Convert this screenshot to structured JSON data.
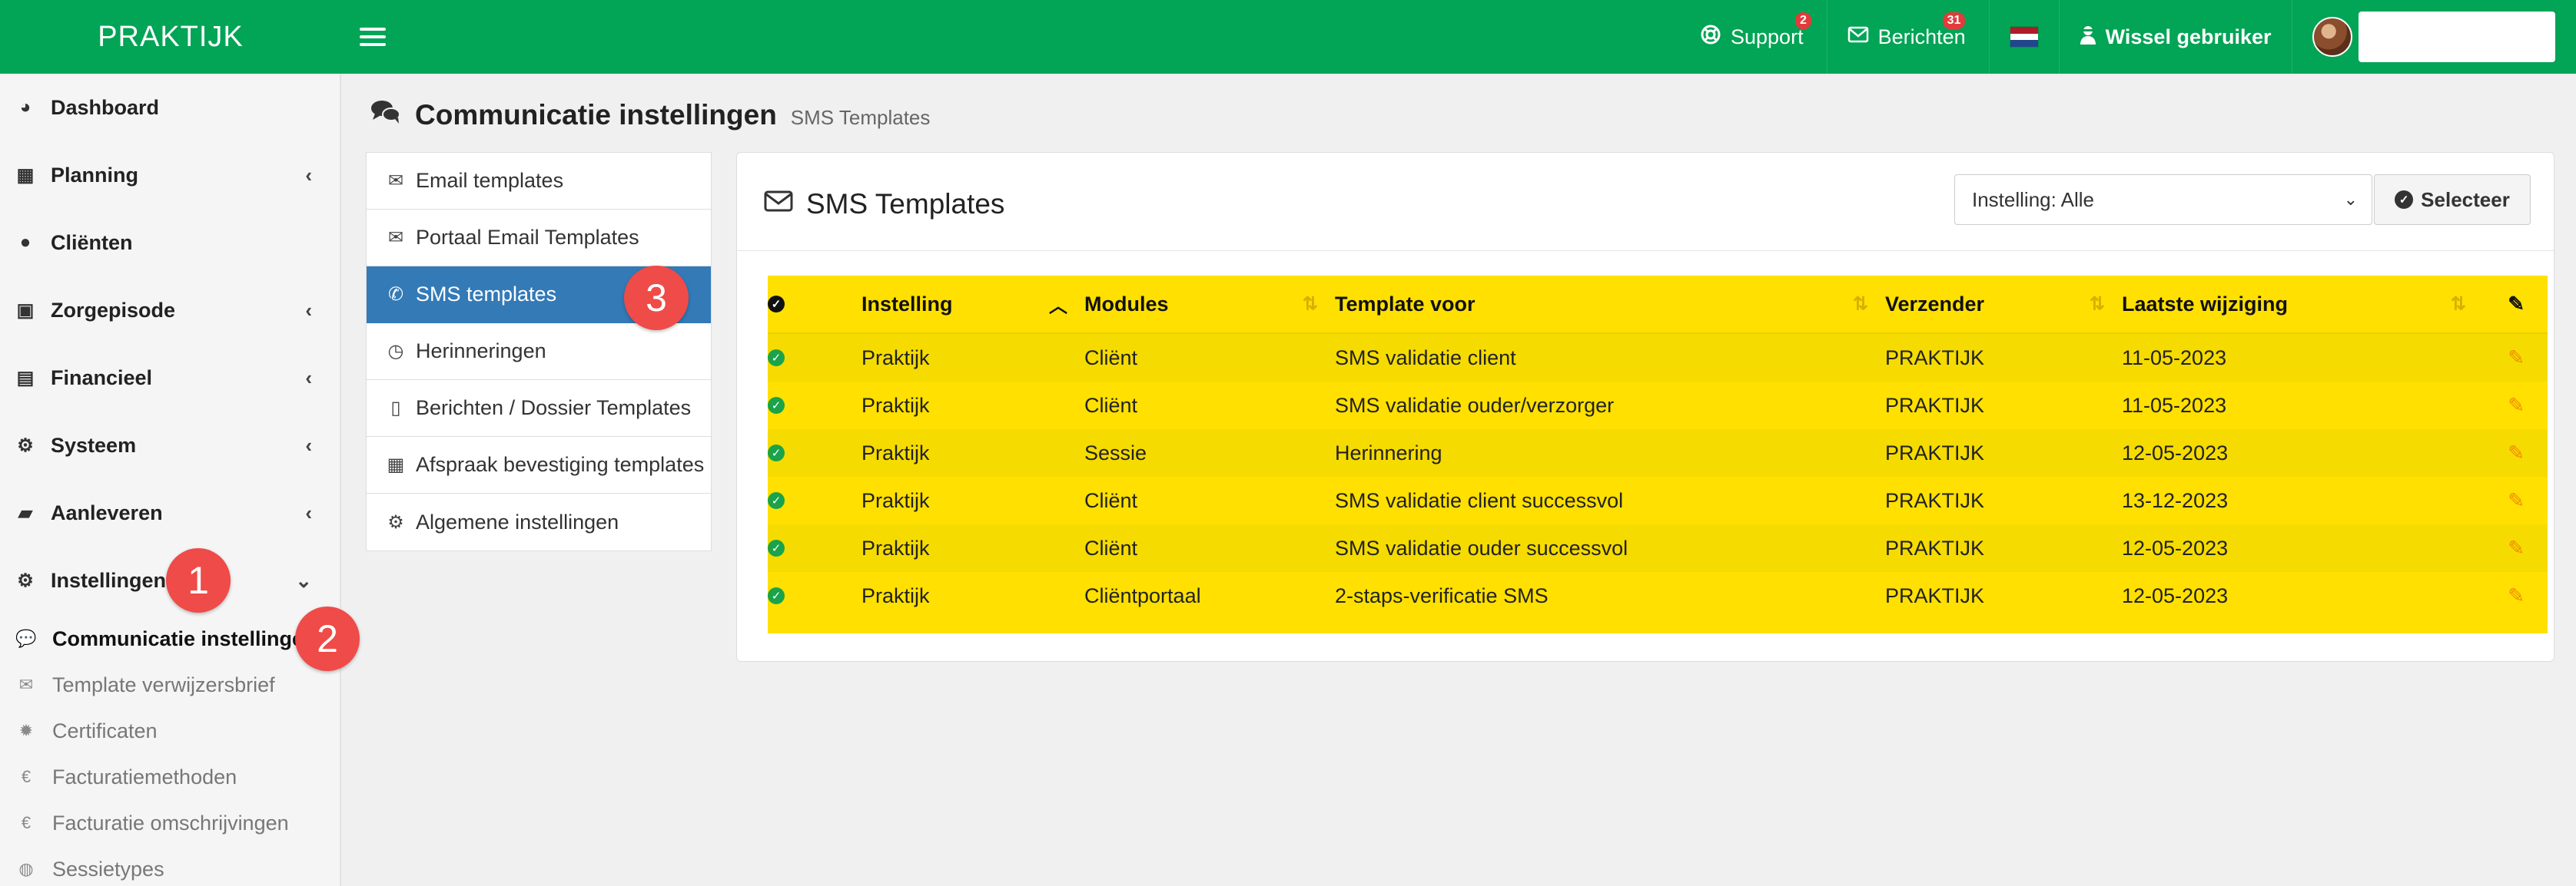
{
  "brand": "PRAKTIJK",
  "topbar": {
    "support": {
      "label": "Support",
      "badge": "2"
    },
    "messages": {
      "label": "Berichten",
      "badge": "31"
    },
    "switch_user": "Wissel gebruiker"
  },
  "sidebar": {
    "items": [
      {
        "label": "Dashboard",
        "icon": "dashboard-icon"
      },
      {
        "label": "Planning",
        "icon": "calendar-icon"
      },
      {
        "label": "Cliënten",
        "icon": "user-icon"
      },
      {
        "label": "Zorgepisode",
        "icon": "medkit-icon"
      },
      {
        "label": "Financieel",
        "icon": "book-icon"
      },
      {
        "label": "Systeem",
        "icon": "cogs-icon"
      },
      {
        "label": "Aanleveren",
        "icon": "truck-icon"
      },
      {
        "label": "Instellingen",
        "icon": "gear-icon"
      }
    ],
    "subitems": [
      {
        "label": "Communicatie instellingen",
        "icon": "comments-icon"
      },
      {
        "label": "Template verwijzersbrief",
        "icon": "envelope-icon"
      },
      {
        "label": "Certificaten",
        "icon": "certificate-icon"
      },
      {
        "label": "Facturatiemethoden",
        "icon": "euro-icon"
      },
      {
        "label": "Facturatie omschrijvingen",
        "icon": "euro-icon"
      },
      {
        "label": "Sessietypes",
        "icon": "globe-icon"
      }
    ]
  },
  "steps": [
    "1",
    "2",
    "3"
  ],
  "page": {
    "title": "Communicatie instellingen",
    "subtitle": "SMS Templates"
  },
  "tabs": [
    {
      "label": "Email templates",
      "icon": "envelope-icon"
    },
    {
      "label": "Portaal Email Templates",
      "icon": "envelope-icon"
    },
    {
      "label": "SMS templates",
      "icon": "phone-icon"
    },
    {
      "label": "Herinneringen",
      "icon": "clock-icon"
    },
    {
      "label": "Berichten / Dossier Templates",
      "icon": "file-icon"
    },
    {
      "label": "Afspraak bevestiging templates",
      "icon": "calendar-check-icon"
    },
    {
      "label": "Algemene instellingen",
      "icon": "gear-icon"
    }
  ],
  "box": {
    "title": "SMS Templates",
    "select_value": "Instelling: Alle",
    "select_button": "Selecteer"
  },
  "table": {
    "headers": [
      "Instelling",
      "Modules",
      "Template voor",
      "Verzender",
      "Laatste wijziging"
    ],
    "rows": [
      [
        "Praktijk",
        "Cliënt",
        "SMS validatie client",
        "PRAKTIJK",
        "11-05-2023"
      ],
      [
        "Praktijk",
        "Cliënt",
        "SMS validatie ouder/verzorger",
        "PRAKTIJK",
        "11-05-2023"
      ],
      [
        "Praktijk",
        "Sessie",
        "Herinnering",
        "PRAKTIJK",
        "12-05-2023"
      ],
      [
        "Praktijk",
        "Cliënt",
        "SMS validatie client successvol",
        "PRAKTIJK",
        "13-12-2023"
      ],
      [
        "Praktijk",
        "Cliënt",
        "SMS validatie ouder successvol",
        "PRAKTIJK",
        "12-05-2023"
      ],
      [
        "Praktijk",
        "Cliëntportaal",
        "2-staps-verificatie SMS",
        "PRAKTIJK",
        "12-05-2023"
      ]
    ]
  },
  "colors": {
    "topbar": "#02a456",
    "active_tab": "#337ab7",
    "table_highlight": "#ffe000",
    "step_marker": "#ef4b48"
  }
}
